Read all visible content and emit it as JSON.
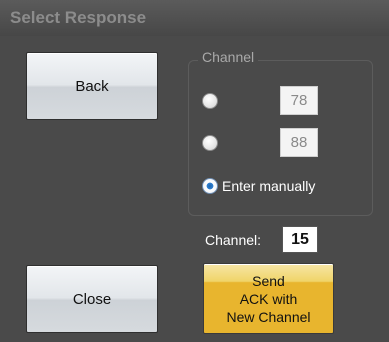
{
  "dialog": {
    "title": "Select Response"
  },
  "buttons": {
    "back_label": "Back",
    "close_label": "Close",
    "send_lines": [
      "Send",
      "ACK with",
      "New Channel"
    ]
  },
  "channel_group": {
    "legend": "Channel",
    "options": [
      {
        "value": "78",
        "selected": false
      },
      {
        "value": "88",
        "selected": false
      },
      {
        "label": "Enter manually",
        "selected": true
      }
    ]
  },
  "manual_channel": {
    "label": "Channel:",
    "value": "15"
  },
  "colors": {
    "panel_bg": "#4a4a4a",
    "send_button": "#e8b52e",
    "title_text": "#8c8c8c"
  }
}
